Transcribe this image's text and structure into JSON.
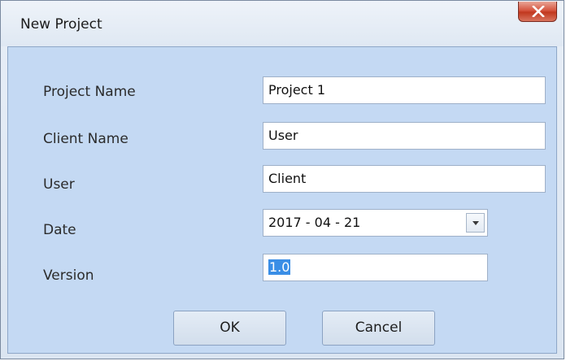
{
  "window": {
    "title": "New Project"
  },
  "form": {
    "project_name": {
      "label": "Project Name",
      "value": "Project 1"
    },
    "client_name": {
      "label": "Client Name",
      "value": "User"
    },
    "user": {
      "label": "User",
      "value": "Client"
    },
    "date": {
      "label": "Date",
      "value": "2017 - 04 - 21"
    },
    "version": {
      "label": "Version",
      "value": "1.0"
    }
  },
  "buttons": {
    "ok": "OK",
    "cancel": "Cancel"
  },
  "icons": {
    "close": "close-icon",
    "dropdown": "chevron-down-icon"
  },
  "colors": {
    "client_area": "#c4d9f3",
    "close_button": "#c1381f",
    "selection": "#3a8ee6"
  }
}
